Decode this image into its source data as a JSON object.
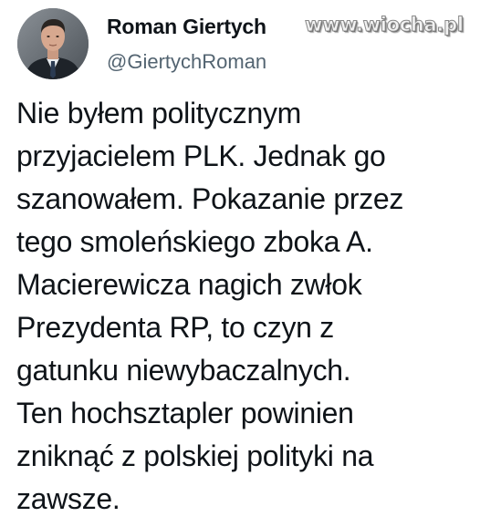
{
  "author": {
    "name": "Roman Giertych",
    "handle": "@GiertychRoman",
    "avatar_icon": "profile-photo"
  },
  "watermark": "www.wiocha.pl",
  "tweet": {
    "lines": [
      "Nie byłem politycznym",
      "przyjacielem PLK. Jednak go",
      "szanowałem. Pokazanie przez",
      "tego smoleńskiego zboka A.",
      "Macierewicza nagich zwłok",
      "Prezydenta RP, to czyn z",
      "gatunku niewybaczalnych.",
      "Ten hochsztapler powinien",
      "zniknąć z polskiej polityki na",
      "zawsze."
    ]
  },
  "colors": {
    "name": "#0f1419",
    "handle": "#536471",
    "text": "#0f1419",
    "background": "#ffffff"
  }
}
